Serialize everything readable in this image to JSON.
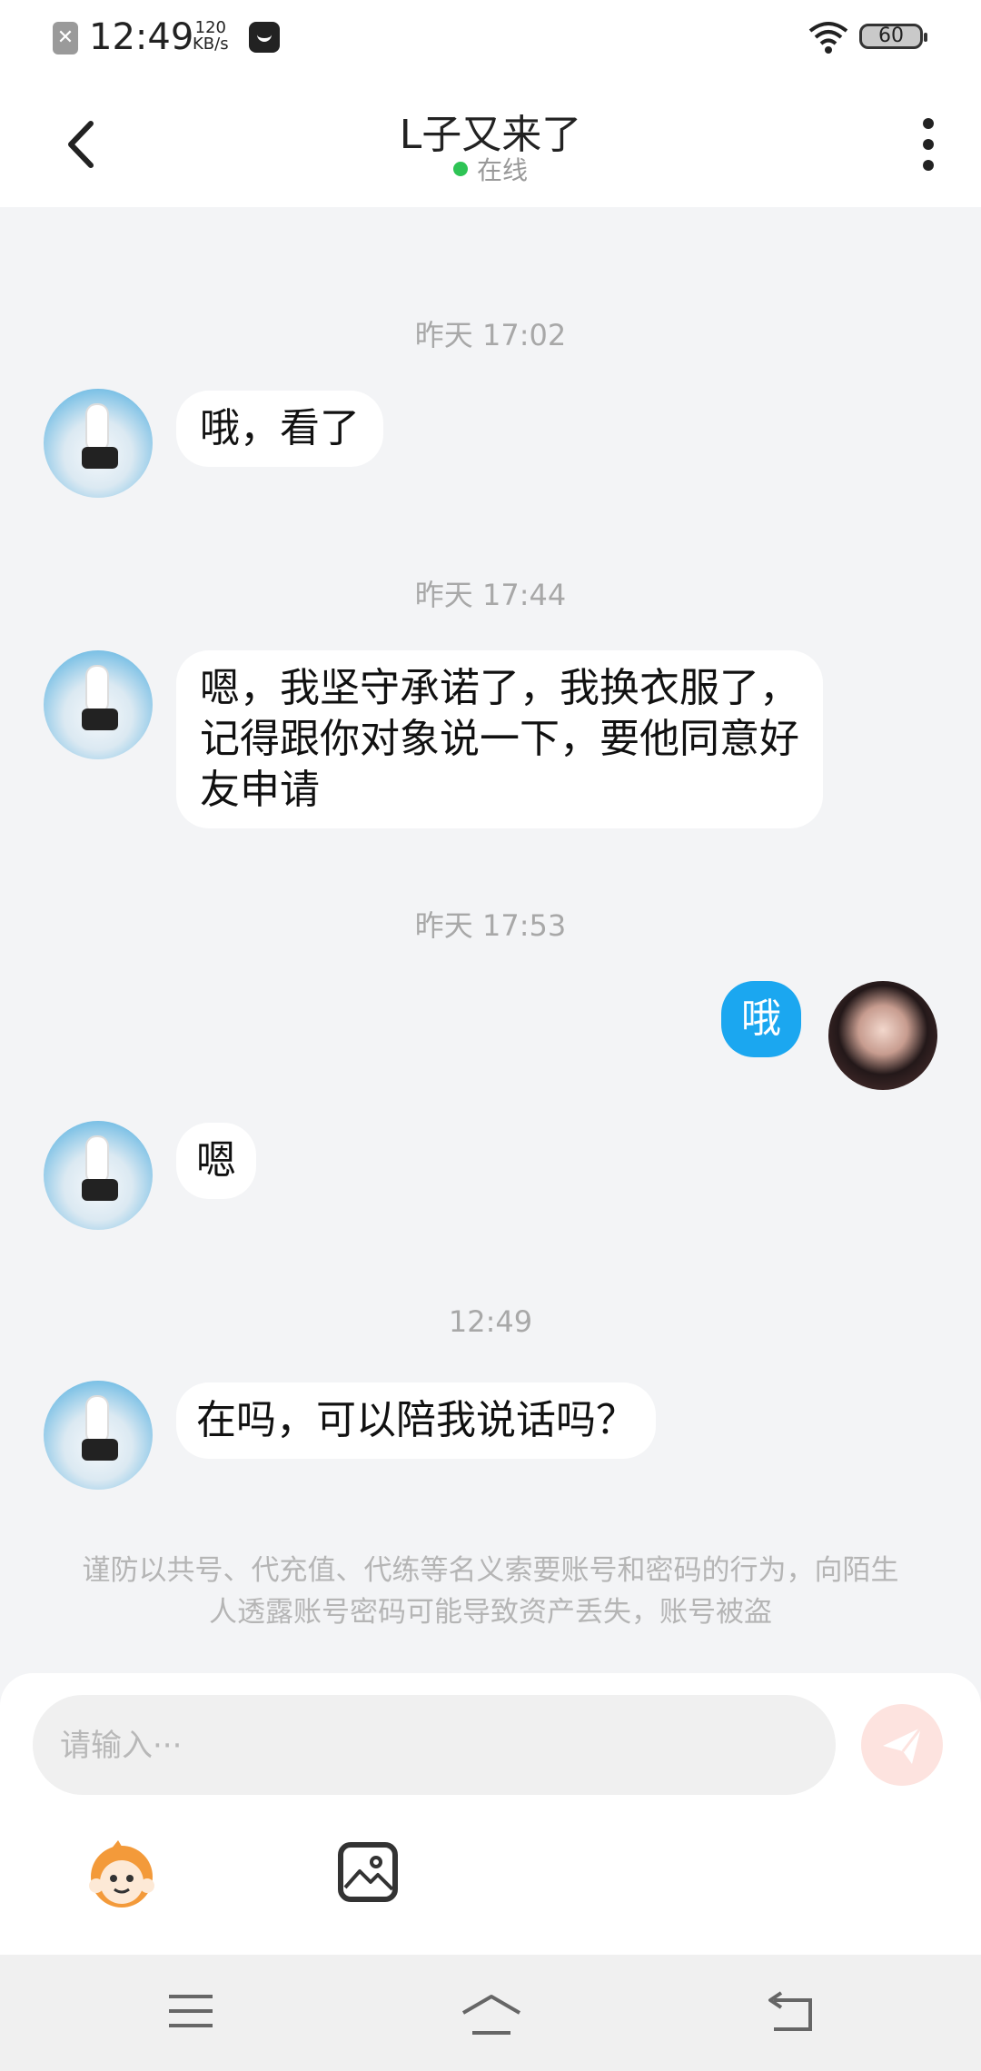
{
  "status_bar": {
    "time": "12:49",
    "net_speed_value": "120",
    "net_speed_unit": "KB/s",
    "battery": "60"
  },
  "header": {
    "title": "L子又来了",
    "status": "在线",
    "status_color": "#2ec455"
  },
  "messages": [
    {
      "type": "time",
      "text": "昨天 17:02"
    },
    {
      "type": "msg",
      "side": "left",
      "text": "哦，看了"
    },
    {
      "type": "time",
      "text": "昨天 17:44"
    },
    {
      "type": "msg",
      "side": "left",
      "text": "嗯，我坚守承诺了，我换衣服了，记得跟你对象说一下，要他同意好友申请"
    },
    {
      "type": "time",
      "text": "昨天 17:53"
    },
    {
      "type": "msg",
      "side": "right",
      "text": "哦"
    },
    {
      "type": "msg",
      "side": "left",
      "text": "嗯"
    },
    {
      "type": "time",
      "text": "12:49"
    },
    {
      "type": "msg",
      "side": "left",
      "text": "在吗，可以陪我说话吗？"
    }
  ],
  "notice": "谨防以共号、代充值、代练等名义索要账号和密码的行为，向陌生人透露账号密码可能导致资产丢失，账号被盗",
  "input": {
    "placeholder": "请输入···"
  },
  "colors": {
    "accent": "#1ba7f0",
    "send_button": "#fde3df"
  },
  "icons": {
    "back": "chevron-left-icon",
    "more": "more-vertical-icon",
    "send": "paper-plane-icon",
    "emoji": "emoji-mascot-icon",
    "image": "image-icon",
    "nav_menu": "menu-icon",
    "nav_home": "home-icon",
    "nav_back": "back-icon"
  }
}
